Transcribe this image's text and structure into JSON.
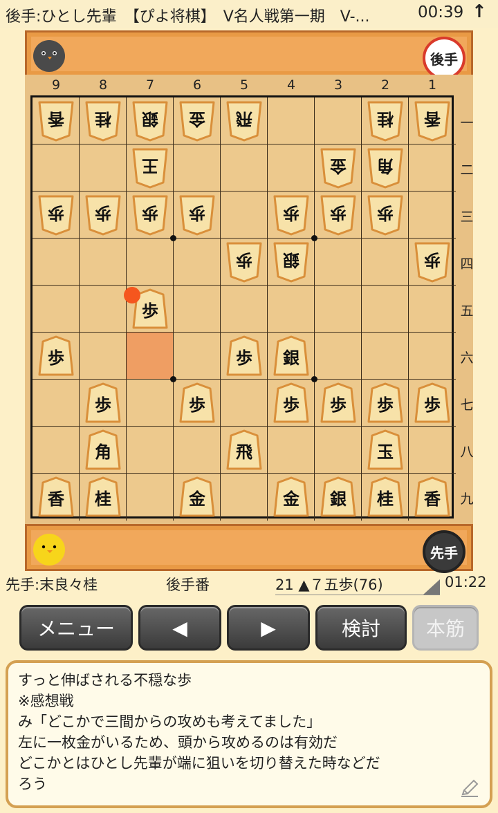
{
  "header": {
    "title": "後手:ひとし先輩　【ぴよ将棋】　V名人戦第一期　V-...",
    "clock": "00:39",
    "scroll_top_icon": "up-arrow-icon"
  },
  "gote_stand": {
    "avatar": "gray-bird-icon",
    "badge": "後手",
    "badge_color": "#d93a2b"
  },
  "sente_stand": {
    "avatar": "yellow-chick-icon",
    "badge": "先手",
    "badge_color": "#3a3a3a"
  },
  "board": {
    "columns": [
      "9",
      "8",
      "7",
      "6",
      "5",
      "4",
      "3",
      "2",
      "1"
    ],
    "rows": [
      "一",
      "二",
      "三",
      "四",
      "五",
      "六",
      "七",
      "八",
      "九"
    ],
    "highlight": {
      "file": 7,
      "rank": 6
    },
    "last_move": {
      "file": 7,
      "rank": 5
    },
    "pieces": [
      {
        "file": 9,
        "rank": 1,
        "label": "香",
        "owner": "gote"
      },
      {
        "file": 8,
        "rank": 1,
        "label": "桂",
        "owner": "gote"
      },
      {
        "file": 7,
        "rank": 1,
        "label": "銀",
        "owner": "gote"
      },
      {
        "file": 6,
        "rank": 1,
        "label": "金",
        "owner": "gote"
      },
      {
        "file": 5,
        "rank": 1,
        "label": "飛",
        "owner": "gote"
      },
      {
        "file": 2,
        "rank": 1,
        "label": "桂",
        "owner": "gote"
      },
      {
        "file": 1,
        "rank": 1,
        "label": "香",
        "owner": "gote"
      },
      {
        "file": 7,
        "rank": 2,
        "label": "王",
        "owner": "gote"
      },
      {
        "file": 3,
        "rank": 2,
        "label": "金",
        "owner": "gote"
      },
      {
        "file": 2,
        "rank": 2,
        "label": "角",
        "owner": "gote"
      },
      {
        "file": 9,
        "rank": 3,
        "label": "歩",
        "owner": "gote"
      },
      {
        "file": 8,
        "rank": 3,
        "label": "歩",
        "owner": "gote"
      },
      {
        "file": 7,
        "rank": 3,
        "label": "歩",
        "owner": "gote"
      },
      {
        "file": 6,
        "rank": 3,
        "label": "歩",
        "owner": "gote"
      },
      {
        "file": 4,
        "rank": 3,
        "label": "歩",
        "owner": "gote"
      },
      {
        "file": 3,
        "rank": 3,
        "label": "歩",
        "owner": "gote"
      },
      {
        "file": 2,
        "rank": 3,
        "label": "歩",
        "owner": "gote"
      },
      {
        "file": 5,
        "rank": 4,
        "label": "歩",
        "owner": "gote"
      },
      {
        "file": 4,
        "rank": 4,
        "label": "銀",
        "owner": "gote"
      },
      {
        "file": 1,
        "rank": 4,
        "label": "歩",
        "owner": "gote"
      },
      {
        "file": 7,
        "rank": 5,
        "label": "歩",
        "owner": "sente"
      },
      {
        "file": 9,
        "rank": 6,
        "label": "歩",
        "owner": "sente"
      },
      {
        "file": 5,
        "rank": 6,
        "label": "歩",
        "owner": "sente"
      },
      {
        "file": 4,
        "rank": 6,
        "label": "銀",
        "owner": "sente"
      },
      {
        "file": 8,
        "rank": 7,
        "label": "歩",
        "owner": "sente"
      },
      {
        "file": 6,
        "rank": 7,
        "label": "歩",
        "owner": "sente"
      },
      {
        "file": 4,
        "rank": 7,
        "label": "歩",
        "owner": "sente"
      },
      {
        "file": 3,
        "rank": 7,
        "label": "歩",
        "owner": "sente"
      },
      {
        "file": 2,
        "rank": 7,
        "label": "歩",
        "owner": "sente"
      },
      {
        "file": 1,
        "rank": 7,
        "label": "歩",
        "owner": "sente"
      },
      {
        "file": 8,
        "rank": 8,
        "label": "角",
        "owner": "sente"
      },
      {
        "file": 5,
        "rank": 8,
        "label": "飛",
        "owner": "sente"
      },
      {
        "file": 2,
        "rank": 8,
        "label": "玉",
        "owner": "sente"
      },
      {
        "file": 9,
        "rank": 9,
        "label": "香",
        "owner": "sente"
      },
      {
        "file": 8,
        "rank": 9,
        "label": "桂",
        "owner": "sente"
      },
      {
        "file": 6,
        "rank": 9,
        "label": "金",
        "owner": "sente"
      },
      {
        "file": 4,
        "rank": 9,
        "label": "金",
        "owner": "sente"
      },
      {
        "file": 3,
        "rank": 9,
        "label": "銀",
        "owner": "sente"
      },
      {
        "file": 2,
        "rank": 9,
        "label": "桂",
        "owner": "sente"
      },
      {
        "file": 1,
        "rank": 9,
        "label": "香",
        "owner": "sente"
      }
    ]
  },
  "status": {
    "sente_player": "先手:末良々桂",
    "turn": "後手番",
    "move": "21 ▲７五歩(76)",
    "move_dropdown_icon": "triangle-corner-icon",
    "time": "01:22"
  },
  "buttons": {
    "menu": "メニュー",
    "prev": "◀",
    "next": "▶",
    "analyze": "検討",
    "mainline": "本筋"
  },
  "comment": {
    "lines": [
      "すっと伸ばされる不穏な歩",
      "※感想戦",
      "み「どこかで三間からの攻めも考えてました」",
      "左に一枚金がいるため、頭から攻めるのは有効だ",
      "どこかとはひとし先輩が端に狙いを切り替えた時などだ",
      "ろう"
    ],
    "edit_icon": "pencil-icon"
  }
}
